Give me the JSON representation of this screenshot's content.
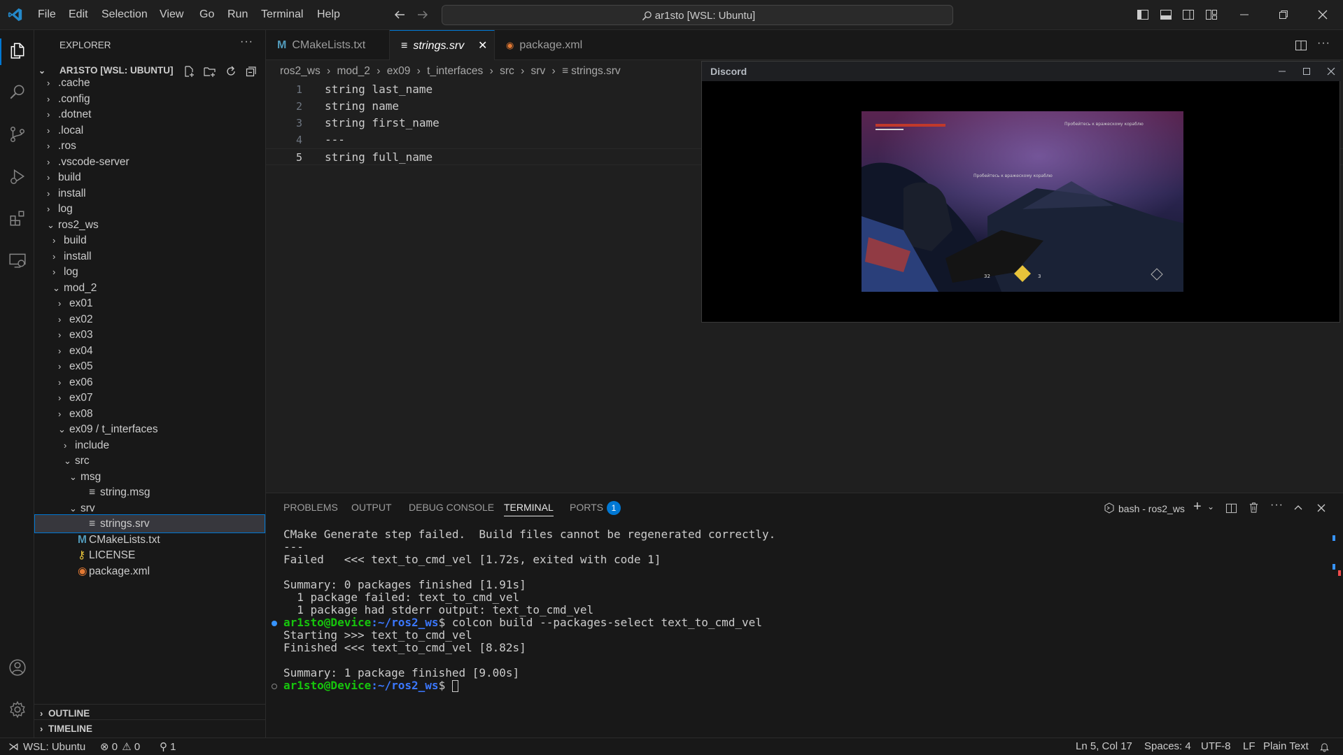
{
  "menu": [
    "File",
    "Edit",
    "Selection",
    "View",
    "Go",
    "Run",
    "Terminal",
    "Help"
  ],
  "command_center": "ar1sto [WSL: Ubuntu]",
  "explorer": {
    "title": "EXPLORER",
    "root": "AR1STO [WSL: UBUNTU]",
    "items": [
      {
        "label": ".cache"
      },
      {
        "label": ".config"
      },
      {
        "label": ".dotnet"
      },
      {
        "label": ".local"
      },
      {
        "label": ".ros"
      },
      {
        "label": ".vscode-server"
      },
      {
        "label": "build"
      },
      {
        "label": "install"
      },
      {
        "label": "log"
      },
      {
        "label": "ros2_ws"
      },
      {
        "label": "build"
      },
      {
        "label": "install"
      },
      {
        "label": "log"
      },
      {
        "label": "mod_2"
      },
      {
        "label": "ex01"
      },
      {
        "label": "ex02"
      },
      {
        "label": "ex03"
      },
      {
        "label": "ex04"
      },
      {
        "label": "ex05"
      },
      {
        "label": "ex06"
      },
      {
        "label": "ex07"
      },
      {
        "label": "ex08"
      },
      {
        "label": "ex09 / t_interfaces"
      },
      {
        "label": "include"
      },
      {
        "label": "src"
      },
      {
        "label": "msg"
      },
      {
        "label": "string.msg"
      },
      {
        "label": "srv"
      },
      {
        "label": "strings.srv"
      },
      {
        "label": "CMakeLists.txt"
      },
      {
        "label": "LICENSE"
      },
      {
        "label": "package.xml"
      }
    ],
    "outline": "OUTLINE",
    "timeline": "TIMELINE"
  },
  "tabs": [
    {
      "label": "CMakeLists.txt"
    },
    {
      "label": "strings.srv"
    },
    {
      "label": "package.xml"
    }
  ],
  "breadcrumb": [
    "ros2_ws",
    "mod_2",
    "ex09",
    "t_interfaces",
    "src",
    "srv",
    "strings.srv"
  ],
  "code": [
    {
      "n": "1",
      "text": "string last_name"
    },
    {
      "n": "2",
      "text": "string name"
    },
    {
      "n": "3",
      "text": "string first_name"
    },
    {
      "n": "4",
      "text": "---"
    },
    {
      "n": "5",
      "text": "string full_name"
    }
  ],
  "discord": {
    "title": "Discord"
  },
  "panel": {
    "tabs": [
      "PROBLEMS",
      "OUTPUT",
      "DEBUG CONSOLE",
      "TERMINAL",
      "PORTS"
    ],
    "ports_badge": "1",
    "terminal_name": "bash - ros2_ws",
    "lines": [
      "CMake Generate step failed.  Build files cannot be regenerated correctly.",
      "---",
      "Failed   <<< text_to_cmd_vel [1.72s, exited with code 1]",
      "",
      "Summary: 0 packages finished [1.91s]",
      "  1 package failed: text_to_cmd_vel",
      "  1 package had stderr output: text_to_cmd_vel"
    ],
    "prompt_user": "ar1sto@Device",
    "prompt_path": ":~/ros2_ws",
    "prompt_sym": "$",
    "cmd1": " colcon build --packages-select text_to_cmd_vel",
    "lines2": [
      "Starting >>> text_to_cmd_vel",
      "Finished <<< text_to_cmd_vel [8.82s]",
      "",
      "Summary: 1 package finished [9.00s]"
    ]
  },
  "status": {
    "remote": "WSL: Ubuntu",
    "errors": "0",
    "warnings": "0",
    "ports": "1",
    "position": "Ln 5, Col 17",
    "spaces": "Spaces: 4",
    "encoding": "UTF-8",
    "eol": "LF",
    "language": "Plain Text"
  }
}
